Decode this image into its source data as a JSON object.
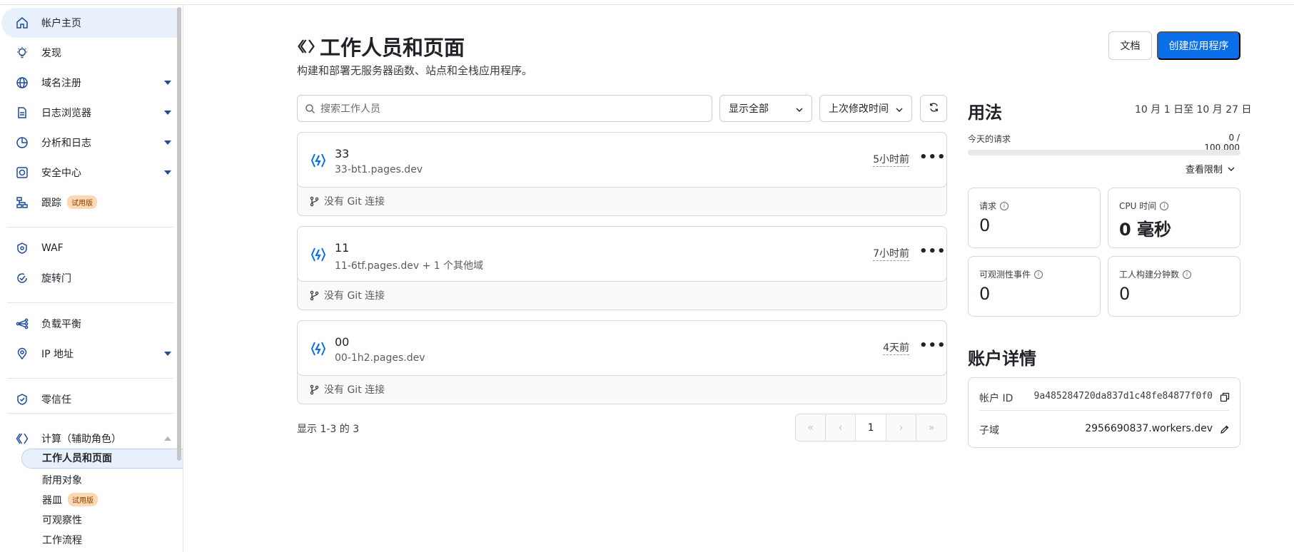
{
  "sidebar": {
    "items": [
      {
        "label": "帐户主页",
        "icon": "home-icon"
      },
      {
        "label": "发现",
        "icon": "lightbulb-icon"
      },
      {
        "label": "域名注册",
        "icon": "globe-icon"
      },
      {
        "label": "日志浏览器",
        "icon": "log-icon"
      },
      {
        "label": "分析和日志",
        "icon": "chart-icon"
      },
      {
        "label": "安全中心",
        "icon": "shield-icon"
      },
      {
        "label": "跟踪",
        "icon": "trace-icon",
        "badge": "试用版"
      },
      {
        "label": "WAF",
        "icon": "waf-icon"
      },
      {
        "label": "旋转门",
        "icon": "turnstile-icon"
      },
      {
        "label": "负载平衡",
        "icon": "load-balance-icon"
      },
      {
        "label": "IP 地址",
        "icon": "location-icon"
      },
      {
        "label": "零信任",
        "icon": "zero-trust-icon"
      },
      {
        "label": "计算（辅助角色）",
        "icon": "compute-icon"
      }
    ],
    "sub_items": [
      {
        "label": "工作人员和页面"
      },
      {
        "label": "耐用对象"
      },
      {
        "label": "器皿",
        "badge": "试用版"
      },
      {
        "label": "可观察性"
      },
      {
        "label": "工作流程"
      }
    ]
  },
  "header": {
    "title": "工作人员和页面",
    "subtitle": "构建和部署无服务器函数、站点和全栈应用程序。",
    "docs_label": "文档",
    "create_label": "创建应用程序"
  },
  "filters": {
    "search_placeholder": "搜索工作人员",
    "show_all": "显示全部",
    "sort": "上次修改时间"
  },
  "workers": [
    {
      "name": "33",
      "domain": "33-bt1.pages.dev",
      "time": "5小时前",
      "git": "没有 Git 连接"
    },
    {
      "name": "11",
      "domain": "11-6tf.pages.dev + 1 个其他域",
      "time": "7小时前",
      "git": "没有 Git 连接"
    },
    {
      "name": "00",
      "domain": "00-1h2.pages.dev",
      "time": "4天前",
      "git": "没有 Git 连接"
    }
  ],
  "pagination": {
    "showing": "显示 1-3 的 3",
    "first": "«",
    "prev": "‹",
    "current": "1",
    "next": "›",
    "last": "»"
  },
  "usage": {
    "title": "用法",
    "range": "10 月 1 日至 10 月 27 日",
    "requests_today_label": "今天的请求",
    "requests_today_value": "0 / 100,000",
    "requests_today_fraction": 0,
    "view_limits": "查看限制",
    "stats": [
      {
        "label": "请求",
        "value": "0"
      },
      {
        "label": "CPU 时间",
        "value": "0 毫秒"
      },
      {
        "label": "可观测性事件",
        "value": "0"
      },
      {
        "label": "工人构建分钟数",
        "value": "0"
      }
    ]
  },
  "account": {
    "title": "账户详情",
    "id_label": "帐户 ID",
    "id_value": "9a485284720da837d1c48fe84877f0f0",
    "subdomain_label": "子域",
    "subdomain_value": "2956690837.workers.dev"
  },
  "colors": {
    "accent": "#0a6fe8",
    "nav_icon": "#1f4b99",
    "active_bg": "#e8f1fb"
  }
}
